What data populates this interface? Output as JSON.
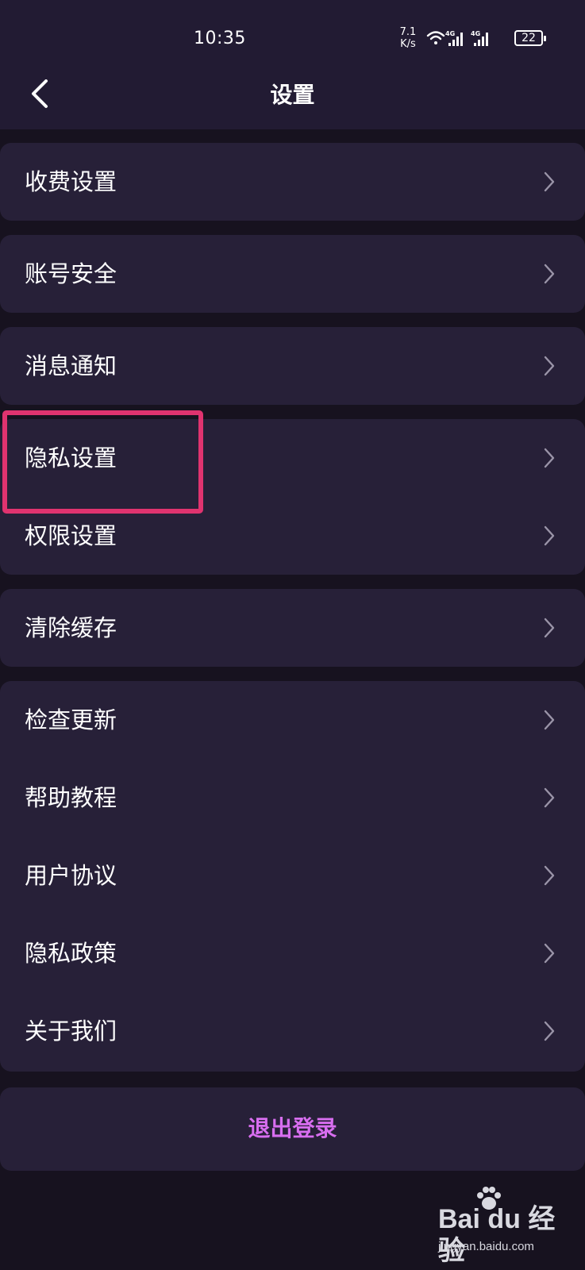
{
  "status_bar": {
    "time": "10:35",
    "net_speed_value": "7.1",
    "net_speed_unit": "K/s",
    "signal_1": "4G",
    "signal_2": "4G",
    "battery_level": "22"
  },
  "nav": {
    "title": "设置",
    "back_icon": "chevron-left-icon"
  },
  "settings": {
    "fee_settings": "收费设置",
    "account_security": "账号安全",
    "message_notifications": "消息通知",
    "privacy_settings": "隐私设置",
    "permission_settings": "权限设置",
    "clear_cache": "清除缓存",
    "check_update": "检查更新",
    "help_tutorial": "帮助教程",
    "user_agreement": "用户协议",
    "privacy_policy": "隐私政策",
    "about_us": "关于我们"
  },
  "logout_label": "退出登录",
  "watermark": {
    "logo_text": "Bai du 经验",
    "site": "jingyan.baidu.com"
  },
  "colors": {
    "background": "#17121f",
    "card": "#272038",
    "header": "#221b33",
    "logout_accent": "#d86ef0",
    "highlight_box": "#e0336f"
  }
}
